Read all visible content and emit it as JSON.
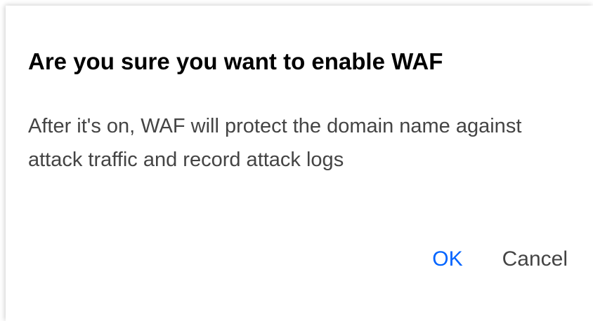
{
  "dialog": {
    "title": "Are you sure you want to enable WAF",
    "message": "After it's on, WAF will protect the domain name against attack traffic and record attack logs",
    "ok_label": "OK",
    "cancel_label": "Cancel"
  },
  "colors": {
    "primary": "#0064ff",
    "text": "#444444",
    "title": "#000000"
  }
}
